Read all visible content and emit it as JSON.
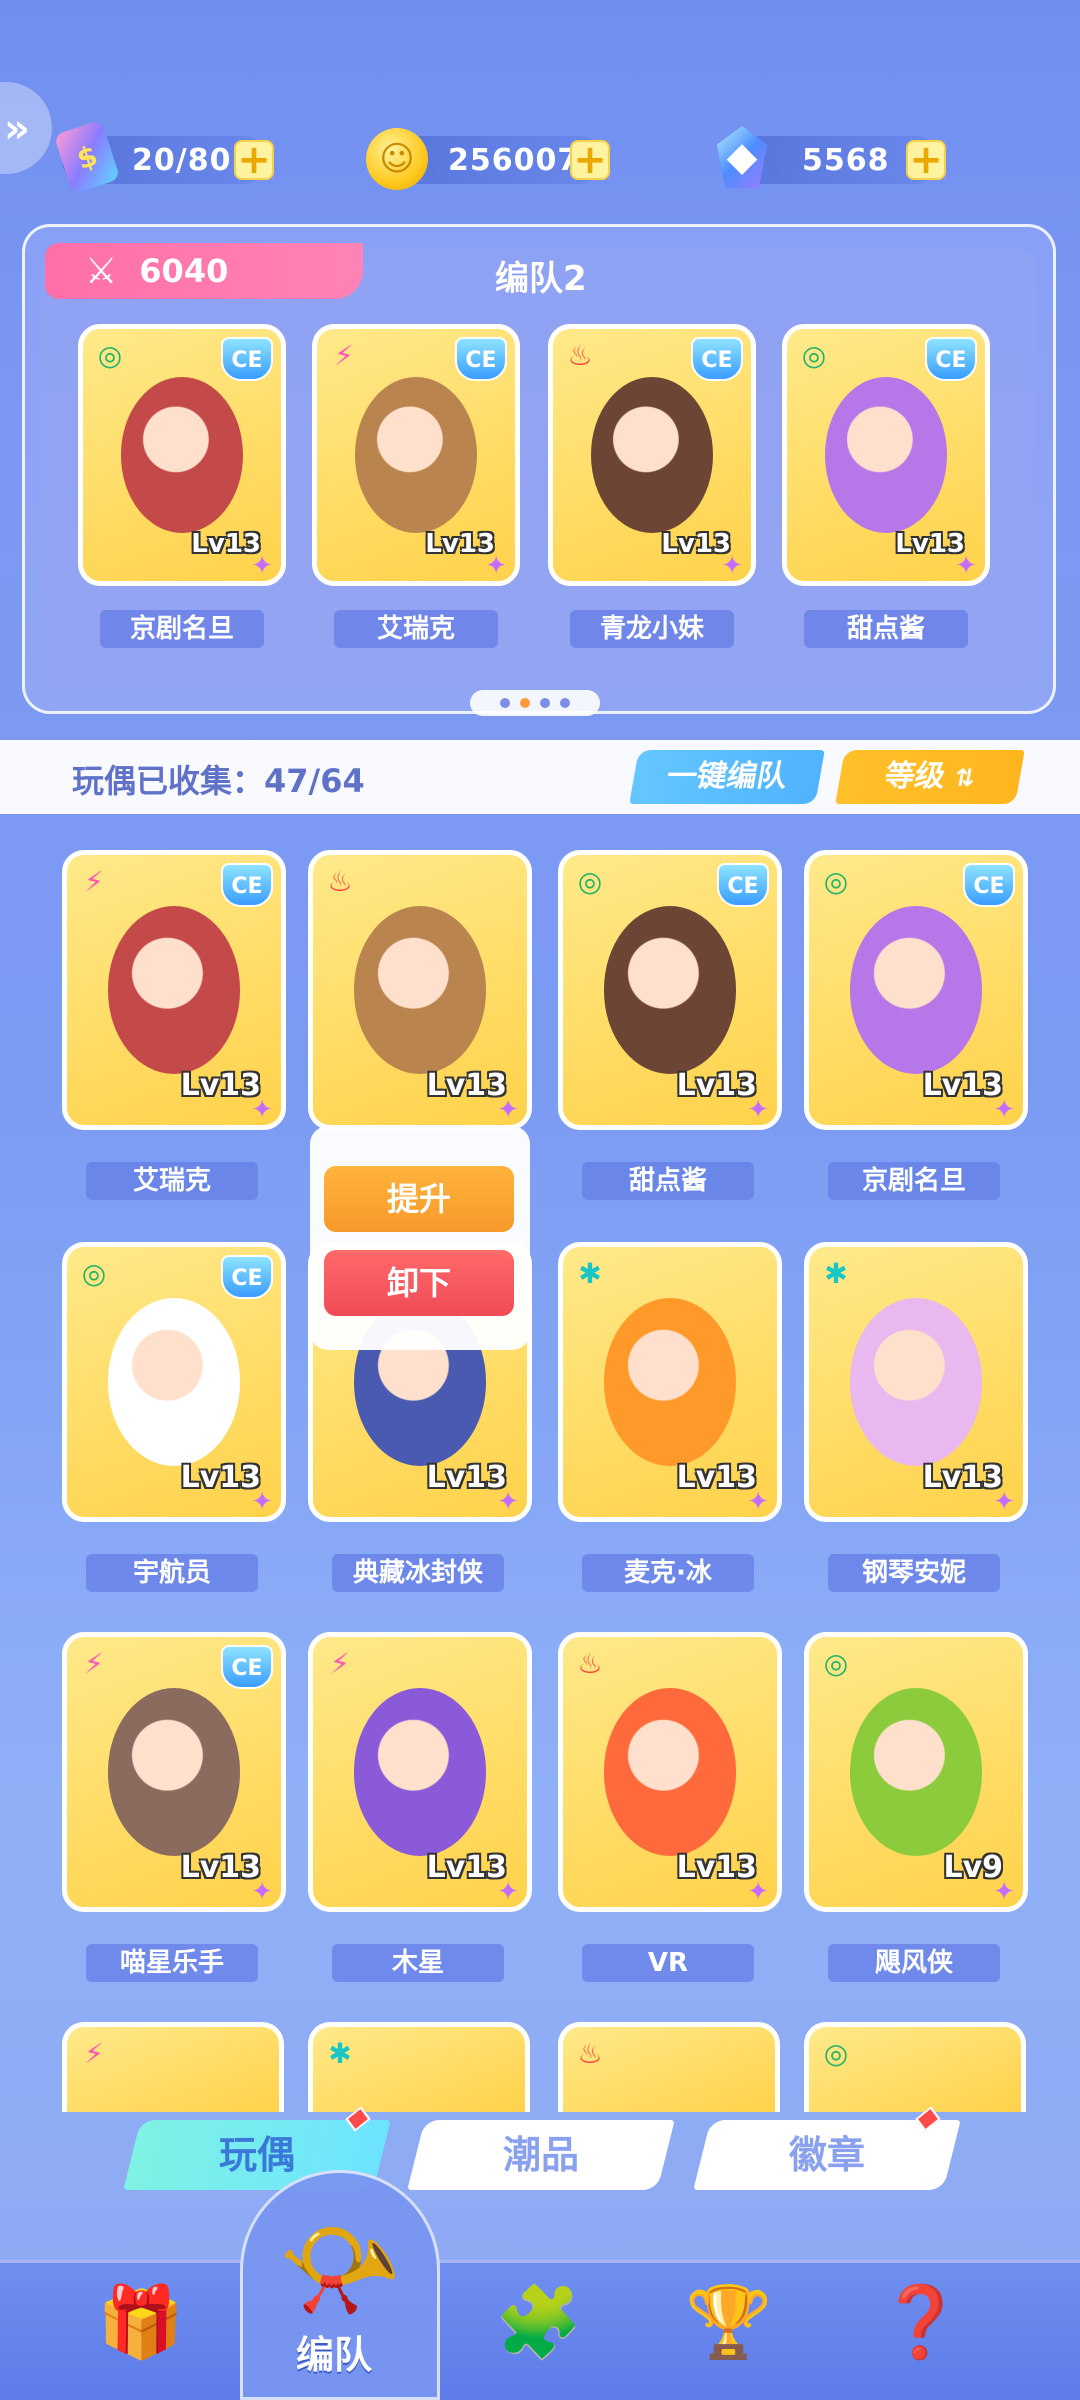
{
  "currencies": [
    {
      "icon": "ticket-icon",
      "value": "20/80"
    },
    {
      "icon": "coin-icon",
      "value": "256007"
    },
    {
      "icon": "gem-icon",
      "value": "5568"
    }
  ],
  "team": {
    "power": "6040",
    "name": "编队2",
    "members": [
      {
        "name": "京剧名旦",
        "level": "Lv13",
        "element": "wind"
      },
      {
        "name": "艾瑞克",
        "level": "Lv13",
        "element": "thunder"
      },
      {
        "name": "青龙小妹",
        "level": "Lv13",
        "element": "fire"
      },
      {
        "name": "甜点酱",
        "level": "Lv13",
        "element": "wind"
      }
    ],
    "page_dots": 4,
    "active_dot": 2
  },
  "collection": {
    "label": "玩偶已收集：47/64",
    "one_click_label": "一键编队",
    "sort_label": "等级"
  },
  "grid": [
    {
      "name": "艾瑞克",
      "level": "Lv13",
      "element": "thunder",
      "ce": true
    },
    {
      "name": "",
      "level": "Lv13",
      "element": "fire",
      "ce": false
    },
    {
      "name": "甜点酱",
      "level": "Lv13",
      "element": "wind",
      "ce": true
    },
    {
      "name": "京剧名旦",
      "level": "Lv13",
      "element": "wind",
      "ce": true
    },
    {
      "name": "宇航员",
      "level": "Lv13",
      "element": "wind",
      "ce": true
    },
    {
      "name": "典藏冰封侠",
      "level": "Lv13",
      "element": "",
      "ce": false
    },
    {
      "name": "麦克·冰",
      "level": "Lv13",
      "element": "ice",
      "ce": false
    },
    {
      "name": "钢琴安妮",
      "level": "Lv13",
      "element": "ice",
      "ce": false
    },
    {
      "name": "喵星乐手",
      "level": "Lv13",
      "element": "thunder",
      "ce": true
    },
    {
      "name": "木星",
      "level": "Lv13",
      "element": "thunder",
      "ce": false
    },
    {
      "name": "VR",
      "level": "Lv13",
      "element": "fire",
      "ce": false
    },
    {
      "name": "飓风侠",
      "level": "Lv9",
      "element": "wind",
      "ce": false
    }
  ],
  "popup": {
    "upgrade_label": "提升",
    "remove_label": "卸下"
  },
  "tabs": [
    "玩偶",
    "潮品",
    "徽章"
  ],
  "nav": {
    "active_label": "编队"
  },
  "colors": {
    "accent_pink": "#ff6fa8",
    "accent_yellow": "#ffc02a",
    "accent_blue": "#4fb3ff",
    "remove_red": "#ef4b55"
  }
}
